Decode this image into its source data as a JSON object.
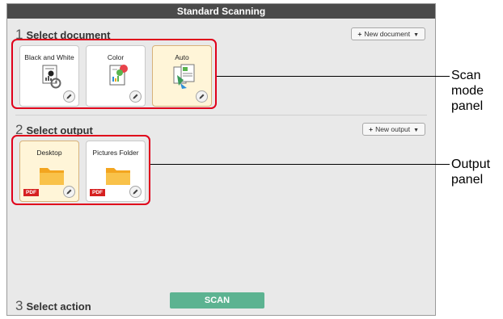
{
  "window": {
    "title": "Standard Scanning"
  },
  "sections": {
    "document": {
      "number": "1",
      "title": "Select document",
      "new_button": "New document"
    },
    "output": {
      "number": "2",
      "title": "Select output",
      "new_button": "New output"
    },
    "action": {
      "number": "3",
      "title": "Select action",
      "scan_button": "SCAN"
    }
  },
  "documents": [
    {
      "label": "Black and White",
      "selected": false,
      "icon": "bw-document-icon"
    },
    {
      "label": "Color",
      "selected": false,
      "icon": "color-document-icon"
    },
    {
      "label": "Auto",
      "selected": true,
      "icon": "auto-document-icon"
    }
  ],
  "outputs": [
    {
      "label": "Desktop",
      "selected": true,
      "badge": "PDF",
      "icon": "folder-icon"
    },
    {
      "label": "Pictures Folder",
      "selected": false,
      "badge": "PDF",
      "icon": "folder-icon"
    }
  ],
  "annotations": {
    "scan_mode": [
      "Scan",
      "mode",
      "panel"
    ],
    "output": [
      "Output",
      "panel"
    ]
  },
  "colors": {
    "titlebar": "#4a4a4a",
    "selected_card": "#fff5d8",
    "scan_button": "#5cb391",
    "highlight_frame": "#e0001b",
    "pdf_badge": "#d62020"
  }
}
